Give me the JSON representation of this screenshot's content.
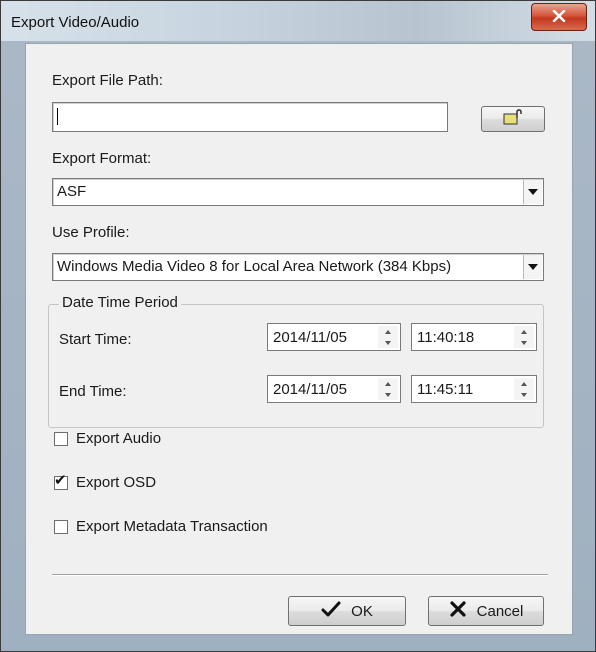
{
  "window": {
    "title": "Export Video/Audio",
    "close_glyph": "✕"
  },
  "export_path": {
    "label": "Export File Path:",
    "value": "",
    "browse_icon": "folder-open-icon"
  },
  "export_format": {
    "label": "Export Format:",
    "selected": "ASF"
  },
  "use_profile": {
    "label": "Use Profile:",
    "selected": "Windows Media Video 8 for Local Area Network (384 Kbps)"
  },
  "date_time_period": {
    "title": "Date Time Period",
    "start": {
      "label": "Start Time:",
      "date": "2014/11/05",
      "time": "11:40:18"
    },
    "end": {
      "label": "End Time:",
      "date": "2014/11/05",
      "time": "11:45:11"
    }
  },
  "options": [
    {
      "label": "Export Audio",
      "checked": false
    },
    {
      "label": "Export OSD",
      "checked": true
    },
    {
      "label": "Export Metadata Transaction",
      "checked": false
    }
  ],
  "buttons": {
    "ok": "OK",
    "cancel": "Cancel"
  }
}
